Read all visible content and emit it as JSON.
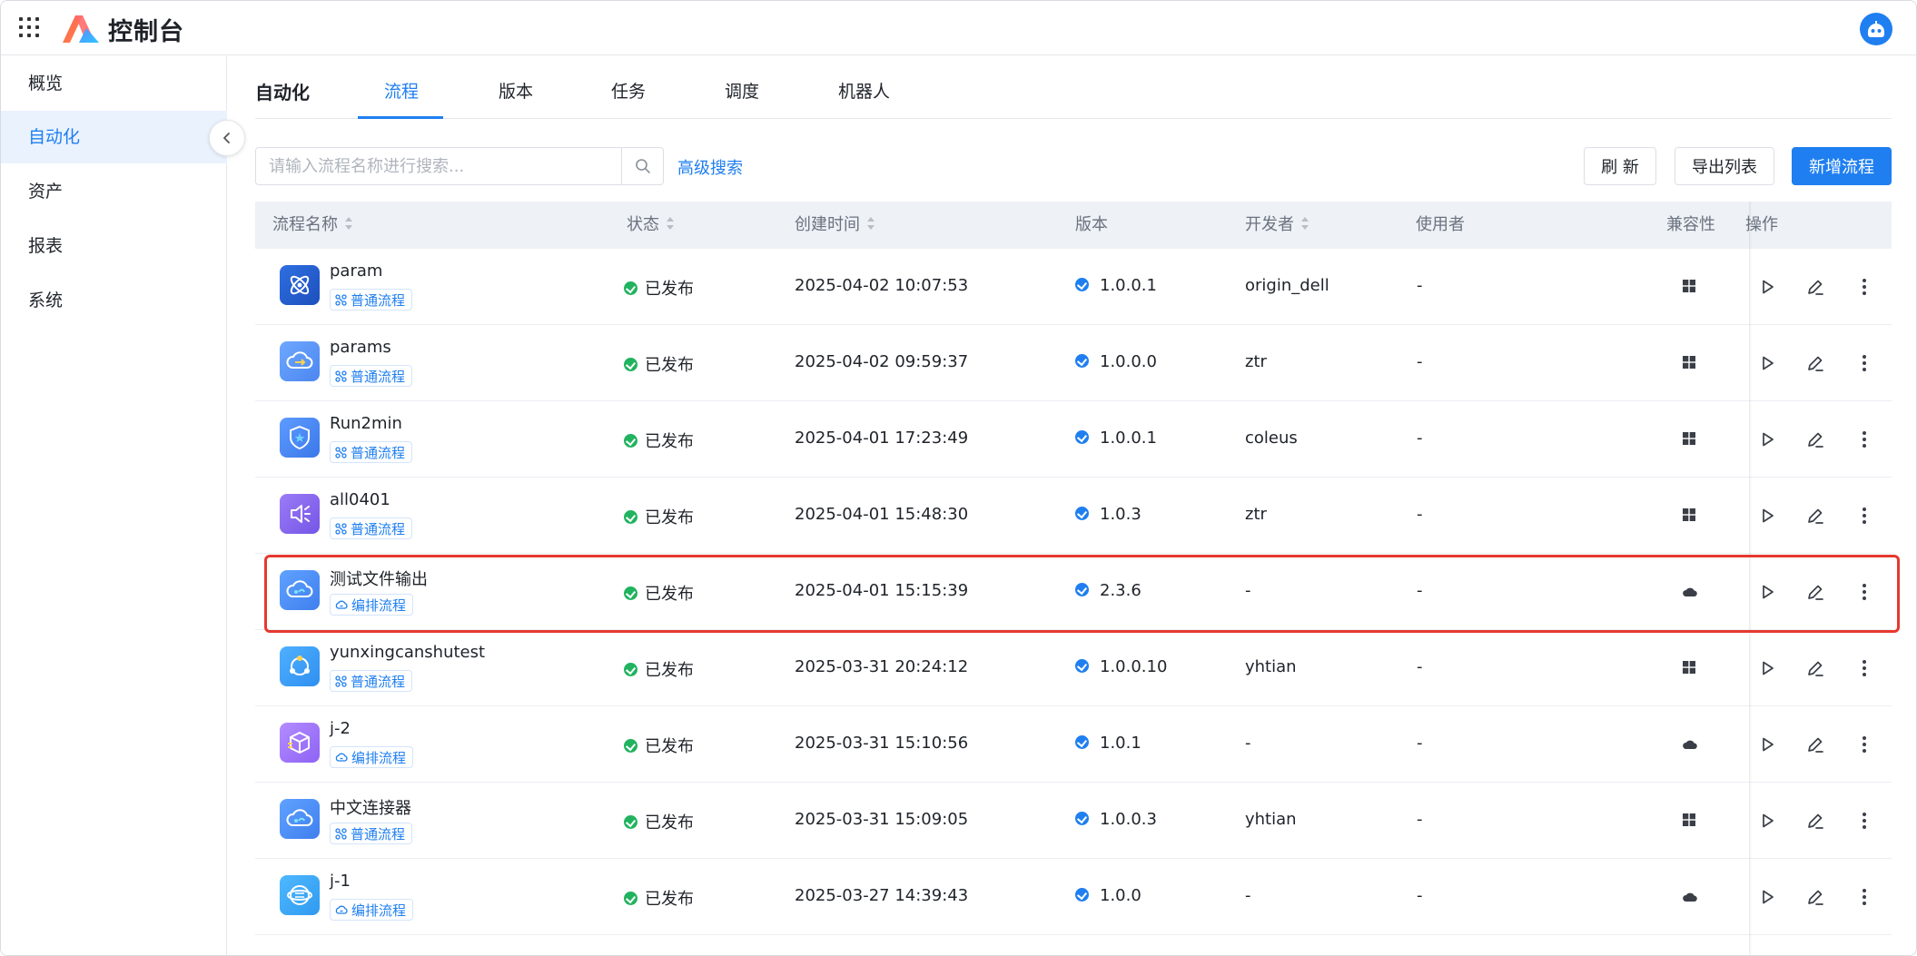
{
  "app": {
    "brand": "控制台",
    "colors": {
      "primary": "#1f7ff0",
      "success": "#21b35f",
      "highlight": "#e5392e"
    }
  },
  "sidebar": {
    "items": [
      {
        "label": "概览",
        "active": false
      },
      {
        "label": "自动化",
        "active": true
      },
      {
        "label": "资产",
        "active": false
      },
      {
        "label": "报表",
        "active": false
      },
      {
        "label": "系统",
        "active": false
      }
    ]
  },
  "header": {
    "title": "自动化",
    "tabs": [
      {
        "label": "流程",
        "active": true
      },
      {
        "label": "版本",
        "active": false
      },
      {
        "label": "任务",
        "active": false
      },
      {
        "label": "调度",
        "active": false
      },
      {
        "label": "机器人",
        "active": false
      }
    ]
  },
  "toolbar": {
    "search_placeholder": "请输入流程名称进行搜索...",
    "advanced_search": "高级搜索",
    "refresh": "刷 新",
    "export": "导出列表",
    "add": "新增流程"
  },
  "table": {
    "columns": {
      "name": "流程名称",
      "status": "状态",
      "created": "创建时间",
      "version": "版本",
      "developer": "开发者",
      "user": "使用者",
      "compat": "兼容性",
      "actions": "操作"
    },
    "rows": [
      {
        "name": "param",
        "tag": "普通流程",
        "status": "已发布",
        "created": "2025-04-02 10:07:53",
        "version": "1.0.0.1",
        "developer": "origin_dell",
        "user": "-",
        "compat": "windows",
        "icon": "atom-icon"
      },
      {
        "name": "params",
        "tag": "普通流程",
        "status": "已发布",
        "created": "2025-04-02 09:59:37",
        "version": "1.0.0.0",
        "developer": "ztr",
        "user": "-",
        "compat": "windows",
        "icon": "cloud-transfer-icon"
      },
      {
        "name": "Run2min",
        "tag": "普通流程",
        "status": "已发布",
        "created": "2025-04-01 17:23:49",
        "version": "1.0.0.1",
        "developer": "coleus",
        "user": "-",
        "compat": "windows",
        "icon": "shield-icon"
      },
      {
        "name": "all0401",
        "tag": "普通流程",
        "status": "已发布",
        "created": "2025-04-01 15:48:30",
        "version": "1.0.3",
        "developer": "ztr",
        "user": "-",
        "compat": "windows",
        "icon": "speaker-icon"
      },
      {
        "name": "测试文件输出",
        "tag": "编排流程",
        "status": "已发布",
        "created": "2025-04-01 15:15:39",
        "version": "2.3.6",
        "developer": "-",
        "user": "-",
        "compat": "cloud",
        "icon": "cloud-sync-icon"
      },
      {
        "name": "yunxingcanshutest",
        "tag": "普通流程",
        "status": "已发布",
        "created": "2025-03-31 20:24:12",
        "version": "1.0.0.10",
        "developer": "yhtian",
        "user": "-",
        "compat": "windows",
        "icon": "network-icon"
      },
      {
        "name": "j-2",
        "tag": "编排流程",
        "status": "已发布",
        "created": "2025-03-31 15:10:56",
        "version": "1.0.1",
        "developer": "-",
        "user": "-",
        "compat": "cloud",
        "icon": "box-icon"
      },
      {
        "name": "中文连接器",
        "tag": "普通流程",
        "status": "已发布",
        "created": "2025-03-31 15:09:05",
        "version": "1.0.0.3",
        "developer": "yhtian",
        "user": "-",
        "compat": "windows",
        "icon": "cloud-sync-icon"
      },
      {
        "name": "j-1",
        "tag": "编排流程",
        "status": "已发布",
        "created": "2025-03-27 14:39:43",
        "version": "1.0.0",
        "developer": "-",
        "user": "-",
        "compat": "cloud",
        "icon": "globe-icon"
      }
    ]
  }
}
